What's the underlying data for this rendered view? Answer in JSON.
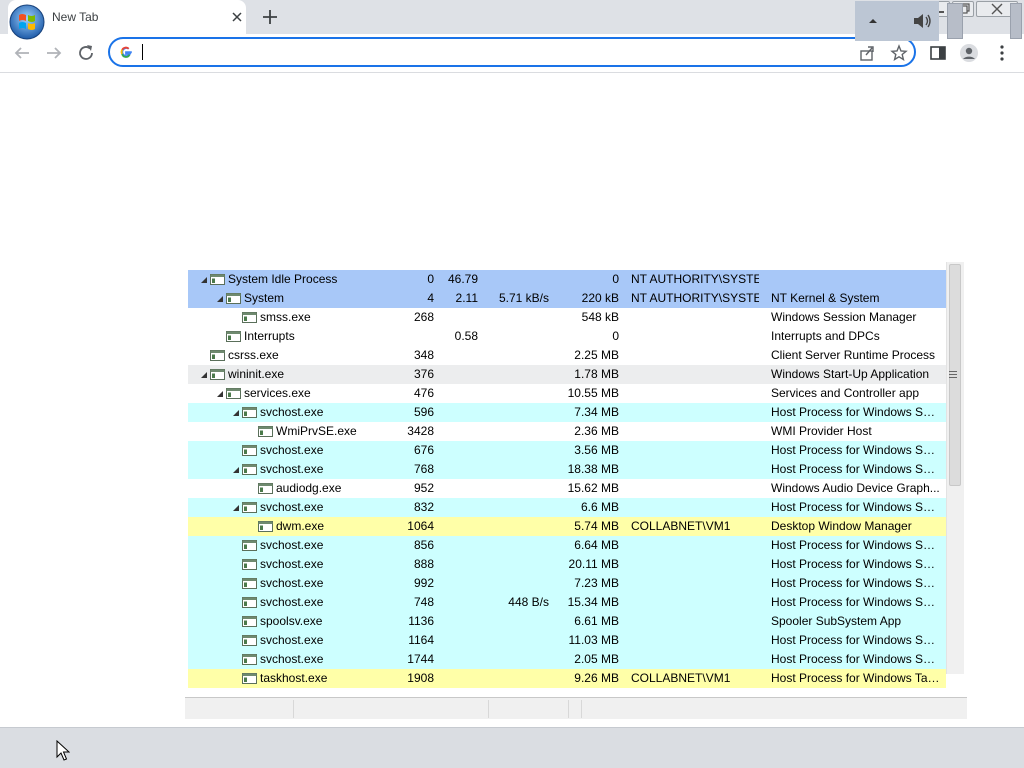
{
  "browser": {
    "tab_title": "New Tab",
    "omnibox_value": "",
    "omnibox_placeholder": ""
  },
  "colors": {
    "accent": "#1a73e8",
    "row_blue": "#a8c8f8",
    "row_cyan": "#cdffff",
    "row_yellow": "#ffffa8"
  },
  "processes": [
    {
      "depth": 0,
      "twisty": true,
      "name": "System Idle Process",
      "pid": "0",
      "cpu": "46.79",
      "io": "",
      "mem": "0",
      "user": "NT AUTHORITY\\SYSTEM",
      "desc": "",
      "hl": "blue"
    },
    {
      "depth": 1,
      "twisty": true,
      "name": "System",
      "pid": "4",
      "cpu": "2.11",
      "io": "5.71 kB/s",
      "mem": "220 kB",
      "user": "NT AUTHORITY\\SYSTEM",
      "desc": "NT Kernel & System",
      "hl": "blue"
    },
    {
      "depth": 2,
      "twisty": false,
      "name": "smss.exe",
      "pid": "268",
      "cpu": "",
      "io": "",
      "mem": "548 kB",
      "user": "",
      "desc": "Windows Session Manager",
      "hl": ""
    },
    {
      "depth": 1,
      "twisty": false,
      "name": "Interrupts",
      "pid": "",
      "cpu": "0.58",
      "io": "",
      "mem": "0",
      "user": "",
      "desc": "Interrupts and DPCs",
      "hl": ""
    },
    {
      "depth": 0,
      "twisty": false,
      "name": "csrss.exe",
      "pid": "348",
      "cpu": "",
      "io": "",
      "mem": "2.25 MB",
      "user": "",
      "desc": "Client Server Runtime Process",
      "hl": ""
    },
    {
      "depth": 0,
      "twisty": true,
      "name": "wininit.exe",
      "pid": "376",
      "cpu": "",
      "io": "",
      "mem": "1.78 MB",
      "user": "",
      "desc": "Windows Start-Up Application",
      "hl": "sel"
    },
    {
      "depth": 1,
      "twisty": true,
      "name": "services.exe",
      "pid": "476",
      "cpu": "",
      "io": "",
      "mem": "10.55 MB",
      "user": "",
      "desc": "Services and Controller app",
      "hl": ""
    },
    {
      "depth": 2,
      "twisty": true,
      "name": "svchost.exe",
      "pid": "596",
      "cpu": "",
      "io": "",
      "mem": "7.34 MB",
      "user": "",
      "desc": "Host Process for Windows Ser...",
      "hl": "cyan"
    },
    {
      "depth": 3,
      "twisty": false,
      "name": "WmiPrvSE.exe",
      "pid": "3428",
      "cpu": "",
      "io": "",
      "mem": "2.36 MB",
      "user": "",
      "desc": "WMI Provider Host",
      "hl": ""
    },
    {
      "depth": 2,
      "twisty": false,
      "name": "svchost.exe",
      "pid": "676",
      "cpu": "",
      "io": "",
      "mem": "3.56 MB",
      "user": "",
      "desc": "Host Process for Windows Ser...",
      "hl": "cyan"
    },
    {
      "depth": 2,
      "twisty": true,
      "name": "svchost.exe",
      "pid": "768",
      "cpu": "",
      "io": "",
      "mem": "18.38 MB",
      "user": "",
      "desc": "Host Process for Windows Ser...",
      "hl": "cyan"
    },
    {
      "depth": 3,
      "twisty": false,
      "name": "audiodg.exe",
      "pid": "952",
      "cpu": "",
      "io": "",
      "mem": "15.62 MB",
      "user": "",
      "desc": "Windows Audio Device Graph...",
      "hl": ""
    },
    {
      "depth": 2,
      "twisty": true,
      "name": "svchost.exe",
      "pid": "832",
      "cpu": "",
      "io": "",
      "mem": "6.6 MB",
      "user": "",
      "desc": "Host Process for Windows Ser...",
      "hl": "cyan"
    },
    {
      "depth": 3,
      "twisty": false,
      "name": "dwm.exe",
      "pid": "1064",
      "cpu": "",
      "io": "",
      "mem": "5.74 MB",
      "user": "COLLABNET\\VM1",
      "desc": "Desktop Window Manager",
      "hl": "yellow"
    },
    {
      "depth": 2,
      "twisty": false,
      "name": "svchost.exe",
      "pid": "856",
      "cpu": "",
      "io": "",
      "mem": "6.64 MB",
      "user": "",
      "desc": "Host Process for Windows Ser...",
      "hl": "cyan"
    },
    {
      "depth": 2,
      "twisty": false,
      "name": "svchost.exe",
      "pid": "888",
      "cpu": "",
      "io": "",
      "mem": "20.11 MB",
      "user": "",
      "desc": "Host Process for Windows Ser...",
      "hl": "cyan"
    },
    {
      "depth": 2,
      "twisty": false,
      "name": "svchost.exe",
      "pid": "992",
      "cpu": "",
      "io": "",
      "mem": "7.23 MB",
      "user": "",
      "desc": "Host Process for Windows Ser...",
      "hl": "cyan"
    },
    {
      "depth": 2,
      "twisty": false,
      "name": "svchost.exe",
      "pid": "748",
      "cpu": "",
      "io": "448 B/s",
      "mem": "15.34 MB",
      "user": "",
      "desc": "Host Process for Windows Ser...",
      "hl": "cyan"
    },
    {
      "depth": 2,
      "twisty": false,
      "name": "spoolsv.exe",
      "pid": "1136",
      "cpu": "",
      "io": "",
      "mem": "6.61 MB",
      "user": "",
      "desc": "Spooler SubSystem App",
      "hl": "cyan"
    },
    {
      "depth": 2,
      "twisty": false,
      "name": "svchost.exe",
      "pid": "1164",
      "cpu": "",
      "io": "",
      "mem": "11.03 MB",
      "user": "",
      "desc": "Host Process for Windows Ser...",
      "hl": "cyan"
    },
    {
      "depth": 2,
      "twisty": false,
      "name": "svchost.exe",
      "pid": "1744",
      "cpu": "",
      "io": "",
      "mem": "2.05 MB",
      "user": "",
      "desc": "Host Process for Windows Ser...",
      "hl": "cyan"
    },
    {
      "depth": 2,
      "twisty": false,
      "name": "taskhost.exe",
      "pid": "1908",
      "cpu": "",
      "io": "",
      "mem": "9.26 MB",
      "user": "COLLABNET\\VM1",
      "desc": "Host Process for Windows Tas...",
      "hl": "yellow"
    }
  ]
}
